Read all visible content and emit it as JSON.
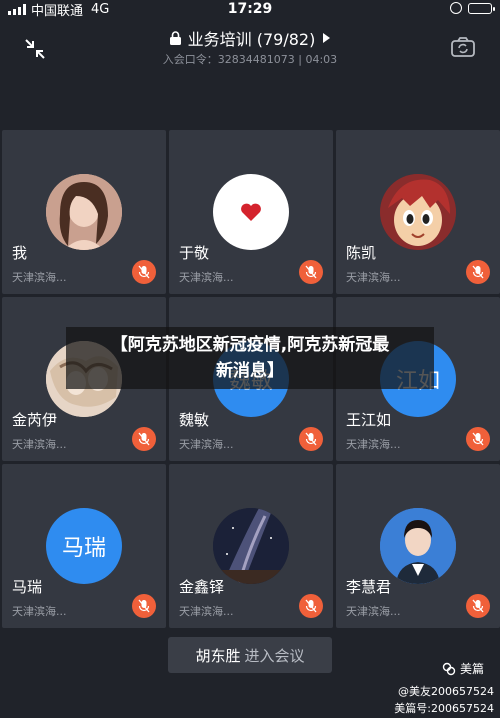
{
  "status": {
    "carrier": "中国联通",
    "network": "4G",
    "time": "17:29"
  },
  "header": {
    "title": "业务培训 (79/82)",
    "meeting_id": "入会口令：32834481073 | 04:03"
  },
  "participants": [
    {
      "name": "我",
      "subtitle": "天津滨海...",
      "avatar": "photo-woman"
    },
    {
      "name": "于敬",
      "subtitle": "天津滨海...",
      "avatar": "heart"
    },
    {
      "name": "陈凯",
      "subtitle": "天津滨海...",
      "avatar": "cartoon"
    },
    {
      "name": "金芮伊",
      "subtitle": "天津滨海...",
      "avatar": "anime"
    },
    {
      "name": "魏敏",
      "subtitle": "天津滨海...",
      "avatar_text": "魏敏"
    },
    {
      "name": "王江如",
      "subtitle": "天津滨海...",
      "avatar_text": "江如"
    },
    {
      "name": "马瑞",
      "subtitle": "天津滨海...",
      "avatar_text": "马瑞"
    },
    {
      "name": "金鑫铎",
      "subtitle": "天津滨海...",
      "avatar": "galaxy"
    },
    {
      "name": "李慧君",
      "subtitle": "天津滨海...",
      "avatar": "photo-suit"
    }
  ],
  "banner": {
    "line1": "【阿克苏地区新冠疫情,阿克苏新冠最",
    "line2": "新消息】"
  },
  "join_toast": {
    "name": "胡东胜",
    "text": "进入会议"
  },
  "watermark": {
    "brand": "美篇",
    "friend": "@美友200657524",
    "account": "美篇号:200657524"
  },
  "colors": {
    "background": "#20232a",
    "tile": "#343841",
    "mic_muted": "#f0603a",
    "avatar_blue": "#2f8cf0"
  }
}
